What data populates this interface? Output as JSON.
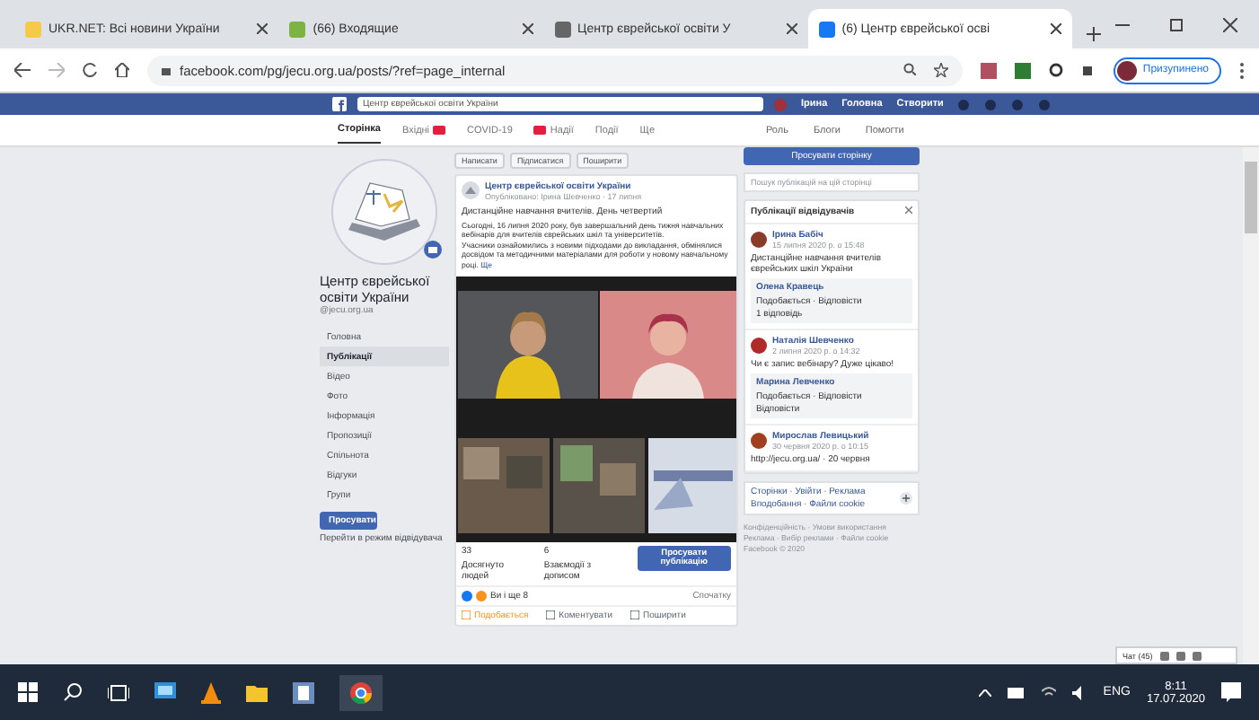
{
  "browser": {
    "tabs": [
      {
        "title": "UKR.NET: Всі новини України",
        "selected": false
      },
      {
        "title": "(66) Входящие",
        "selected": false
      },
      {
        "title": "Центр єврейської освіти У",
        "selected": false
      },
      {
        "title": "(6) Центр єврейської осві",
        "selected": true
      }
    ],
    "url": "facebook.com/pg/jecu.org.ua/posts/?ref=page_internal",
    "profile": "Призупинено"
  },
  "facebook": {
    "search": "Центр єврейської освіти України",
    "top_nav": [
      "Ірина",
      "Головна",
      "Створити"
    ],
    "page_nav": [
      {
        "label": "Сторінка",
        "selected": true,
        "badge": false
      },
      {
        "label": "Вхідні",
        "selected": false,
        "badge": true
      },
      {
        "label": "COVID-19",
        "selected": false,
        "badge": false
      },
      {
        "label": "Надії",
        "selected": false,
        "badge": true
      },
      {
        "label": "Події",
        "selected": false,
        "badge": false
      },
      {
        "label": "Ще",
        "selected": false,
        "badge": false
      }
    ],
    "page_nav_right": [
      "Роль",
      "Блоги",
      "Помогти"
    ]
  },
  "sidebar": {
    "page_name": "Центр єврейської освіти України",
    "handle": "@jecu.org.ua",
    "items": [
      {
        "label": "Головна",
        "selected": false
      },
      {
        "label": "Публікації",
        "selected": true
      },
      {
        "label": "Відео",
        "selected": false
      },
      {
        "label": "Фото",
        "selected": false
      },
      {
        "label": "Інформація",
        "selected": false
      },
      {
        "label": "Пропозиції",
        "selected": false
      },
      {
        "label": "Спільнота",
        "selected": false
      },
      {
        "label": "Відгуки",
        "selected": false
      },
      {
        "label": "Групи",
        "selected": false
      }
    ],
    "promote_button": "Просувати",
    "visitor_link": "Перейти в режим відвідувача"
  },
  "post": {
    "chips": [
      "Написати",
      "Підписатися",
      "Поширити"
    ],
    "author": "Центр єврейської освіти України",
    "meta": "Опубліковано: Ірина Шевченко · 17 липня",
    "heading": "Дистанційне навчання вчителів. День четвертий",
    "body": [
      "Сьогодні, 16 липня 2020 року, був завершальний день тижня навчальних вебінарів для вчителів єврейських шкіл та університетів.",
      "Учасники ознайомились з новими підходами до викладання, обмінялися досвідом та методичними матеріалами для роботи у новому навчальному році."
    ],
    "more": "Ще",
    "reach": "33",
    "reach_label": "Досягнуто людей",
    "engagement": "6",
    "engagement_label": "Взаємодії з дописом",
    "boost": "Просувати публікацію",
    "likes": "Ви і ще 8",
    "sort": "Спочатку",
    "actions": [
      "Подобається",
      "Коментувати",
      "Поширити"
    ]
  },
  "right": {
    "promote": "Просувати сторінку",
    "search_placeholder": "Пошук публікацій на цій сторінці",
    "section": "Публікації відвідувачів",
    "comments": [
      {
        "name": "Ірина Бабіч",
        "time": "15 липня 2020 р. о 15:48",
        "text": "Дистанційне навчання вчителів єврейських шкіл України",
        "reply_name": "Олена Кравець",
        "reply": "Подобається · Відповісти",
        "extra": "1 відповідь"
      },
      {
        "name": "Наталія Шевченко",
        "time": "2 липня 2020 р. о 14:32",
        "text": "Чи є запис вебінару? Дуже цікаво!",
        "reply_name": "Марина Левченко",
        "reply": "Подобається · Відповісти",
        "extra": "Відповісти"
      },
      {
        "name": "Мирослав Левицький",
        "time": "30 червня 2020 р. о 10:15",
        "text": "http://jecu.org.ua/ · 20 червня"
      }
    ],
    "footer_card": [
      "Сторінки · Увійти · Реклама",
      "Вподобання · Файли cookie"
    ],
    "footer": [
      "Конфіденційність · Умови використання",
      "Реклама · Вибір реклами · Файли cookie",
      "Facebook © 2020"
    ],
    "chat": "Чат (45)"
  },
  "taskbar": {
    "language": "ENG",
    "time": "8:11",
    "date": "17.07.2020"
  }
}
